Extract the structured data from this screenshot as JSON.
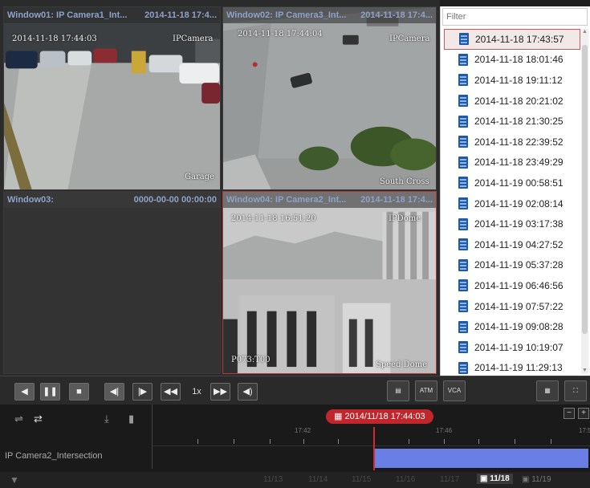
{
  "windows": [
    {
      "title": "Window01: IP Camera1_Int...",
      "time": "2014-11-18 17:4...",
      "osd_time": "2014-11-18 17:44:03",
      "osd_name": "IPCamera",
      "osd_label": "Garage"
    },
    {
      "title": "Window02: IP Camera3_Int...",
      "time": "2014-11-18 17:4...",
      "osd_time": "2014-11-18 17:44:04",
      "osd_name": "IPCamera",
      "osd_label": "South Cross"
    },
    {
      "title": "Window03:",
      "time": "0000-00-00 00:00:00"
    },
    {
      "title": "Window04: IP Camera2_Int...",
      "time": "2014-11-18 17:4...",
      "osd_time": "2014-11-18 16:51:20",
      "osd_name": "IPDome",
      "osd_label": "Speed Dome",
      "osd_ptz": "P073:T00"
    }
  ],
  "panel": {
    "filter_placeholder": "Filter",
    "items": [
      "2014-11-18 17:43:57",
      "2014-11-18 18:01:46",
      "2014-11-18 19:11:12",
      "2014-11-18 20:21:02",
      "2014-11-18 21:30:25",
      "2014-11-18 22:39:52",
      "2014-11-18 23:49:29",
      "2014-11-19 00:58:51",
      "2014-11-19 02:08:14",
      "2014-11-19 03:17:38",
      "2014-11-19 04:27:52",
      "2014-11-19 05:37:28",
      "2014-11-19 06:46:56",
      "2014-11-19 07:57:22",
      "2014-11-19 09:08:28",
      "2014-11-19 10:19:07",
      "2014-11-19 11:29:13"
    ]
  },
  "controls": {
    "speed": "1x",
    "tool_atm": "ATM",
    "tool_vca": "VCA"
  },
  "timeline": {
    "current": "2014/11/18 17:44:03",
    "camera": "IP Camera2_Intersection",
    "ticks": [
      "17:42",
      "17:46",
      "17:5"
    ],
    "days": [
      "11/13",
      "11/14",
      "11/15",
      "11/16",
      "11/17",
      "11/18",
      "11/19"
    ],
    "zoom_out": "−",
    "zoom_in": "+"
  },
  "colors": {
    "accent": "#c0262b",
    "record_bar": "#6a7fe6",
    "title_text": "#8fa2c9"
  }
}
